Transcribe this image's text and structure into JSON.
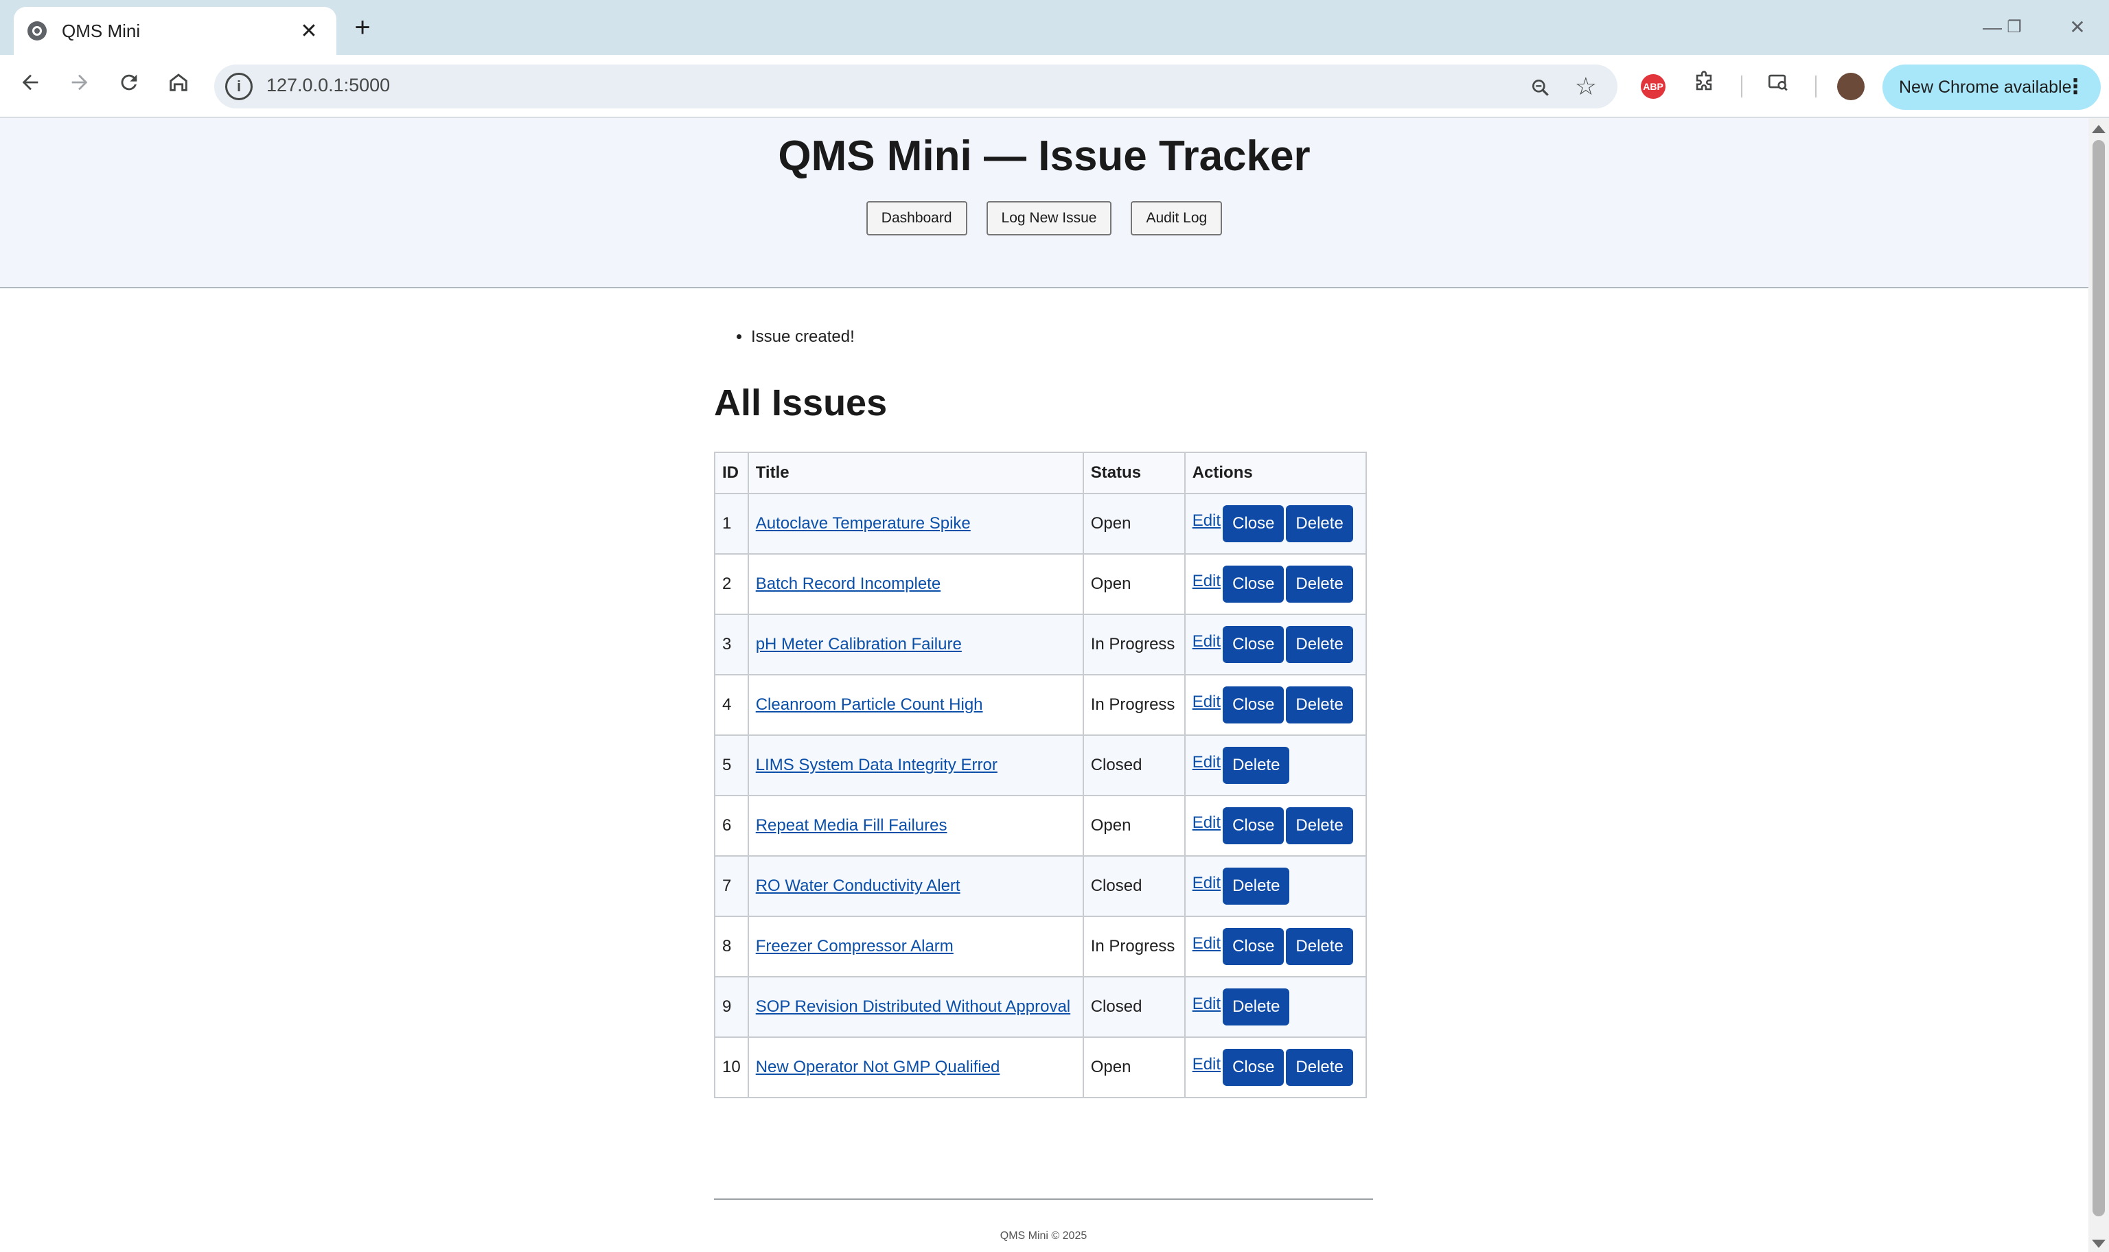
{
  "browser": {
    "tab_title": "QMS Mini",
    "tab_close": "✕",
    "new_tab": "+",
    "url": "127.0.0.1:5000",
    "update_label": "New Chrome available",
    "update_menu": "⋮",
    "abp_label": "ABP",
    "window_controls": {
      "minimize": "—",
      "restore": "❐",
      "close": "✕"
    },
    "icons": {
      "back": "back-arrow-icon",
      "forward": "forward-arrow-icon",
      "reload": "reload-icon",
      "home": "home-icon",
      "info": "info-icon",
      "zoom": "zoom-icon",
      "star": "star-icon",
      "extensions": "puzzle-icon",
      "media": "media-search-icon"
    }
  },
  "header": {
    "title": "QMS Mini — Issue Tracker",
    "nav": [
      "Dashboard",
      "Log New Issue",
      "Audit Log"
    ]
  },
  "flash": [
    "Issue created!"
  ],
  "issues": {
    "heading": "All Issues",
    "columns": [
      "ID",
      "Title",
      "Status",
      "Actions"
    ],
    "action_labels": {
      "edit": "Edit",
      "close": "Close",
      "delete": "Delete"
    },
    "rows": [
      {
        "id": "1",
        "title": "Autoclave Temperature Spike",
        "status": "Open"
      },
      {
        "id": "2",
        "title": "Batch Record Incomplete",
        "status": "Open"
      },
      {
        "id": "3",
        "title": "pH Meter Calibration Failure",
        "status": "In Progress"
      },
      {
        "id": "4",
        "title": "Cleanroom Particle Count High",
        "status": "In Progress"
      },
      {
        "id": "5",
        "title": "LIMS System Data Integrity Error",
        "status": "Closed"
      },
      {
        "id": "6",
        "title": "Repeat Media Fill Failures",
        "status": "Open"
      },
      {
        "id": "7",
        "title": "RO Water Conductivity Alert",
        "status": "Closed"
      },
      {
        "id": "8",
        "title": "Freezer Compressor Alarm",
        "status": "In Progress"
      },
      {
        "id": "9",
        "title": "SOP Revision Distributed Without Approval",
        "status": "Closed"
      },
      {
        "id": "10",
        "title": "New Operator Not GMP Qualified",
        "status": "Open"
      }
    ]
  },
  "footer": "QMS Mini © 2025",
  "colors": {
    "header_bg": "#f2f6fc",
    "action_button": "#0e4aa6",
    "link": "#0b4fa8",
    "update_pill": "#a8e7fa"
  }
}
